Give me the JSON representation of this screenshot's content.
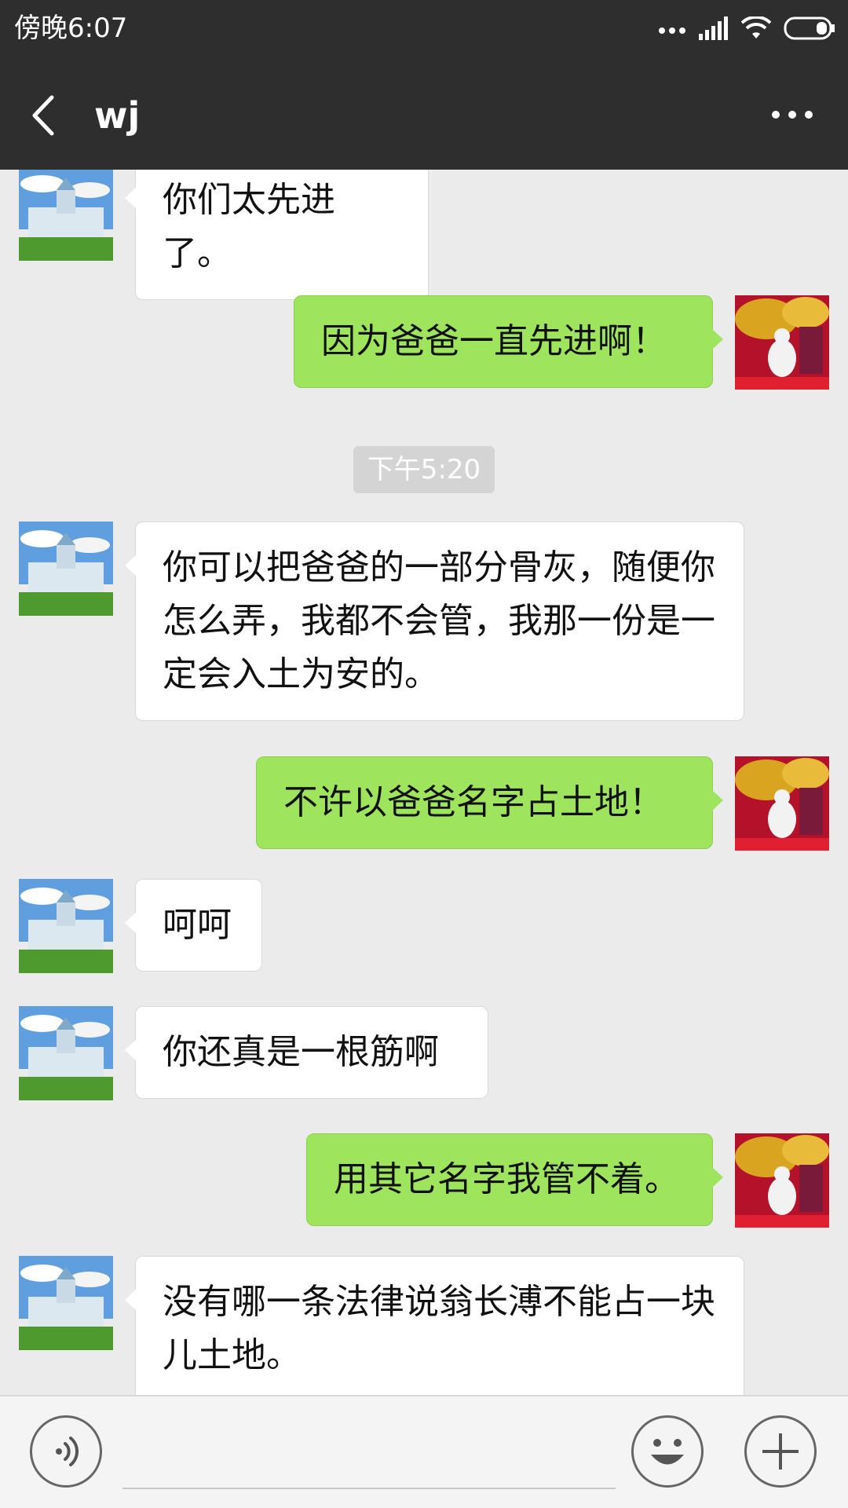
{
  "status_bar": {
    "time": "傍晚6:07"
  },
  "header": {
    "title": "wj"
  },
  "messages": [
    {
      "side": "in",
      "text": "你们太先进了。"
    },
    {
      "side": "out",
      "text": "因为爸爸一直先进啊！"
    },
    {
      "side": "in",
      "text": "你可以把爸爸的一部分骨灰，随便你怎么弄，我都不会管，我那一份是一定会入土为安的。"
    },
    {
      "side": "out",
      "text": "不许以爸爸名字占土地！"
    },
    {
      "side": "in",
      "text": "呵呵"
    },
    {
      "side": "in",
      "text": "你还真是一根筋啊"
    },
    {
      "side": "out",
      "text": "用其它名字我管不着。"
    },
    {
      "side": "in",
      "text": "没有哪一条法律说翁长溥不能占一块儿土地。"
    }
  ],
  "timestamp": "下午5:20",
  "input": {
    "value": ""
  },
  "colors": {
    "title_bar": "#2e2e2e",
    "chat_background": "#ebebeb",
    "outgoing_bubble": "#9ee55d",
    "incoming_bubble": "#ffffff"
  }
}
